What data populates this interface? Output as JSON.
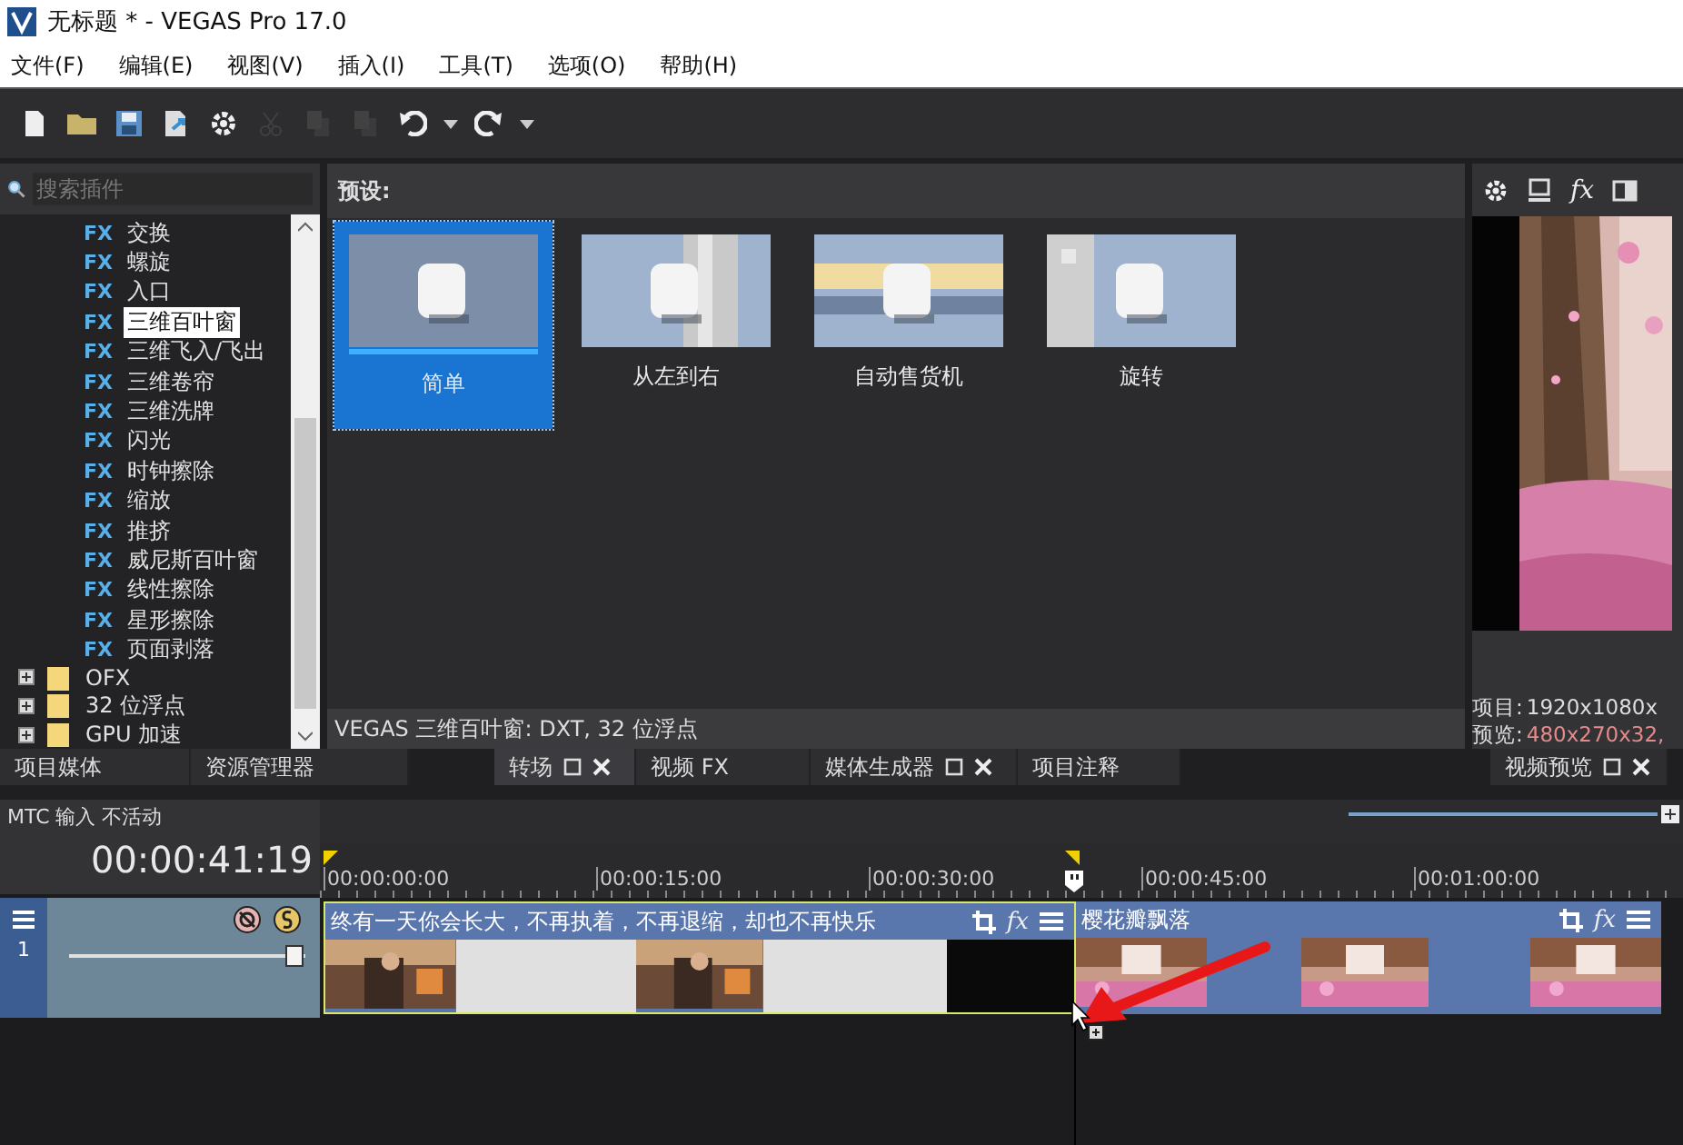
{
  "window": {
    "title": "无标题 * - VEGAS Pro 17.0"
  },
  "menu": [
    "文件(F)",
    "编辑(E)",
    "视图(V)",
    "插入(I)",
    "工具(T)",
    "选项(O)",
    "帮助(H)"
  ],
  "toolbar": [
    {
      "disabled": false
    },
    {
      "disabled": false
    },
    {
      "disabled": false
    },
    {
      "disabled": false
    },
    {
      "disabled": false
    },
    {
      "disabled": true
    },
    {
      "disabled": true
    },
    {
      "disabled": true
    },
    {
      "disabled": false
    },
    {
      "disabled": false
    },
    {
      "disabled": false
    },
    {
      "disabled": false
    }
  ],
  "plugin_panel": {
    "search": {
      "placeholder": "搜索插件"
    },
    "tree": [
      {
        "kind": "fx",
        "badge": "FX",
        "label": "交换",
        "selected": false
      },
      {
        "kind": "fx",
        "badge": "FX",
        "label": "螺旋",
        "selected": false
      },
      {
        "kind": "fx",
        "badge": "FX",
        "label": "入口",
        "selected": false
      },
      {
        "kind": "fx",
        "badge": "FX",
        "label": "三维百叶窗",
        "selected": true
      },
      {
        "kind": "fx",
        "badge": "FX",
        "label": "三维飞入/飞出",
        "selected": false
      },
      {
        "kind": "fx",
        "badge": "FX",
        "label": "三维卷帘",
        "selected": false
      },
      {
        "kind": "fx",
        "badge": "FX",
        "label": "三维洗牌",
        "selected": false
      },
      {
        "kind": "fx",
        "badge": "FX",
        "label": "闪光",
        "selected": false
      },
      {
        "kind": "fx",
        "badge": "FX",
        "label": "时钟擦除",
        "selected": false
      },
      {
        "kind": "fx",
        "badge": "FX",
        "label": "缩放",
        "selected": false
      },
      {
        "kind": "fx",
        "badge": "FX",
        "label": "推挤",
        "selected": false
      },
      {
        "kind": "fx",
        "badge": "FX",
        "label": "威尼斯百叶窗",
        "selected": false
      },
      {
        "kind": "fx",
        "badge": "FX",
        "label": "线性擦除",
        "selected": false
      },
      {
        "kind": "fx",
        "badge": "FX",
        "label": "星形擦除",
        "selected": false
      },
      {
        "kind": "fx",
        "badge": "FX",
        "label": "页面剥落",
        "selected": false
      },
      {
        "kind": "folder",
        "label": "OFX",
        "selected": false,
        "expanded": false
      },
      {
        "kind": "folder",
        "label": "32 位浮点",
        "selected": false,
        "expanded": false
      },
      {
        "kind": "folder",
        "label": "GPU 加速",
        "selected": false,
        "expanded": false
      }
    ]
  },
  "presets": {
    "heading": "预设:",
    "items": [
      {
        "label": "简单",
        "selected": true
      },
      {
        "label": "从左到右",
        "selected": false
      },
      {
        "label": "自动售货机",
        "selected": false
      },
      {
        "label": "旋转",
        "selected": false
      }
    ],
    "status": "VEGAS 三维百叶窗: DXT, 32 位浮点"
  },
  "preview": {
    "toolbar_fx": "fx",
    "info": [
      {
        "label": "项目:",
        "value": "1920x1080x",
        "highlighted": false
      },
      {
        "label": "预览:",
        "value": "480x270x32,",
        "highlighted": true
      }
    ]
  },
  "dock_tabs": [
    {
      "label": "项目媒体",
      "selected": false,
      "closable": false
    },
    {
      "label": "资源管理器",
      "selected": false,
      "closable": false
    },
    {
      "label": "转场",
      "selected": true,
      "closable": true
    },
    {
      "label": "视频 FX",
      "selected": false,
      "closable": false
    },
    {
      "label": "媒体生成器",
      "selected": false,
      "closable": true
    },
    {
      "label": "项目注释",
      "selected": false,
      "closable": false
    }
  ],
  "preview_tab": {
    "label": "视频预览",
    "selected": false,
    "closable": true
  },
  "timeline": {
    "mtc": "MTC 输入 不活动",
    "time": "00:00:41:19",
    "ruler": [
      "00:00:00:00",
      "00:00:15:00",
      "00:00:30:00",
      "00:00:45:00",
      "00:01:00:00"
    ],
    "track": {
      "number": "1",
      "level": 0.95
    },
    "clips": [
      {
        "title": "终有一天你会长大，不再执着，不再退缩，却也不再快乐",
        "selected": true,
        "fx": "fx"
      },
      {
        "title": "樱花瓣飘落",
        "selected": false,
        "fx": "fx"
      }
    ]
  }
}
